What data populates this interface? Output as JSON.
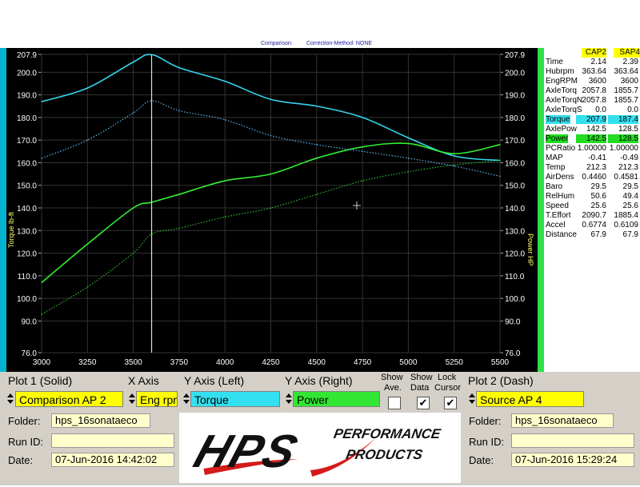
{
  "header": {
    "comparison_label": "Comparison:",
    "correction_label": "Correction-Method: NONE"
  },
  "chart_data": {
    "type": "line",
    "x": [
      3000,
      3250,
      3500,
      3600,
      3750,
      4000,
      4250,
      4500,
      4750,
      5000,
      5250,
      5500
    ],
    "xlim": [
      3000,
      5500
    ],
    "ylim": [
      76.0,
      207.9
    ],
    "y_left_label": "Torque lb-ft",
    "y_right_label": "Power HP",
    "x_ticks": [
      "3000",
      "3250",
      "3500",
      "3750",
      "4000",
      "4250",
      "4500",
      "4750",
      "5000",
      "5250",
      "5500"
    ],
    "y_ticks": [
      "207.9",
      "200.0",
      "190.0",
      "180.0",
      "170.0",
      "160.0",
      "150.0",
      "140.0",
      "130.0",
      "120.0",
      "110.0",
      "100.0",
      "90.0",
      "76.0"
    ],
    "cursor_x": 3600,
    "series": [
      {
        "name": "Torque",
        "color": "#33d6ee",
        "style": "solid",
        "values": [
          187.0,
          193.0,
          204.5,
          207.8,
          202.0,
          196.0,
          188.0,
          185.0,
          180.0,
          171.0,
          163.0,
          161.0
        ]
      },
      {
        "name": "Power",
        "color": "#33ee33",
        "style": "solid",
        "values": [
          107.0,
          124.0,
          140.0,
          142.5,
          146.0,
          152.0,
          155.0,
          162.0,
          167.0,
          168.5,
          164.0,
          168.0
        ]
      },
      {
        "name": "Torque",
        "color": "#5bb5ee",
        "style": "dotted",
        "values": [
          162.0,
          170.0,
          182.0,
          187.4,
          183.0,
          179.0,
          172.0,
          168.0,
          165.0,
          162.0,
          158.5,
          154.0
        ]
      },
      {
        "name": "Power",
        "color": "#2fbf2f",
        "style": "dotted",
        "values": [
          93.0,
          105.0,
          120.0,
          128.5,
          131.0,
          136.0,
          140.0,
          146.0,
          152.0,
          156.0,
          159.0,
          161.0
        ]
      }
    ]
  },
  "readout": {
    "col1": "CAP2",
    "col2": "SAP4",
    "rows": [
      {
        "label": "Time",
        "v1": "2.14",
        "v2": "2.39"
      },
      {
        "label": "Hubrpm",
        "v1": "363.64",
        "v2": "363.64"
      },
      {
        "label": "EngRPM",
        "v1": "3600",
        "v2": "3600"
      },
      {
        "label": "AxleTorq",
        "v1": "2057.8",
        "v2": "1855.7"
      },
      {
        "label": "AxleTorqN",
        "v1": "2057.8",
        "v2": "1855.7"
      },
      {
        "label": "AxleTorqS",
        "v1": "0.0",
        "v2": "0.0"
      },
      {
        "label": "Torque",
        "v1": "207.9",
        "v2": "187.4"
      },
      {
        "label": "AxlePow",
        "v1": "142.5",
        "v2": "128.5"
      },
      {
        "label": "Power",
        "v1": "142.5",
        "v2": "128.5"
      },
      {
        "label": "PCRatio",
        "v1": "1.00000",
        "v2": "1.00000"
      },
      {
        "label": "MAP",
        "v1": "-0.41",
        "v2": "-0.49"
      },
      {
        "label": "Temp",
        "v1": "212.3",
        "v2": "212.3"
      },
      {
        "label": "AirDens",
        "v1": "0.4460",
        "v2": "0.4581"
      },
      {
        "label": "Baro",
        "v1": "29.5",
        "v2": "29.5"
      },
      {
        "label": "RelHum",
        "v1": "50.6",
        "v2": "49.4"
      },
      {
        "label": "Speed",
        "v1": "25.6",
        "v2": "25.6"
      },
      {
        "label": "T.Effort",
        "v1": "2090.7",
        "v2": "1885.4"
      },
      {
        "label": "Accel",
        "v1": "0.6774",
        "v2": "0.6109"
      },
      {
        "label": "Distance",
        "v1": "67.9",
        "v2": "67.9"
      }
    ]
  },
  "controls": {
    "plot1_label": "Plot 1 (Solid)",
    "plot1_value": "Comparison AP 2",
    "xaxis_label": "X Axis",
    "xaxis_value": "Eng rpm",
    "yleft_label": "Y Axis (Left)",
    "yleft_value": "Torque",
    "yright_label": "Y Axis (Right)",
    "yright_value": "Power",
    "show_ave_label1": "Show",
    "show_ave_label2": "Ave.",
    "show_data_label1": "Show",
    "show_data_label2": "Data",
    "lock_cursor_label1": "Lock",
    "lock_cursor_label2": "Cursor",
    "show_data_checked": "✔",
    "lock_cursor_checked": "✔",
    "plot2_label": "Plot 2 (Dash)",
    "plot2_value": "Source AP 4"
  },
  "plot1_info": {
    "folder_label": "Folder:",
    "folder_value": "hps_16sonataeco",
    "runid_label": "Run ID:",
    "runid_value": "",
    "date_label": "Date:",
    "date_value": "07-Jun-2016   14:42:02"
  },
  "plot2_info": {
    "folder_label": "Folder:",
    "folder_value": "hps_16sonataeco",
    "runid_label": "Run ID:",
    "runid_value": "",
    "date_label": "Date:",
    "date_value": "07-Jun-2016   15:29:24"
  },
  "logo": {
    "brand": "HPS",
    "line1": "PERFORMANCE",
    "line2": "PRODUCTS",
    "accent": "#d41a1a"
  }
}
